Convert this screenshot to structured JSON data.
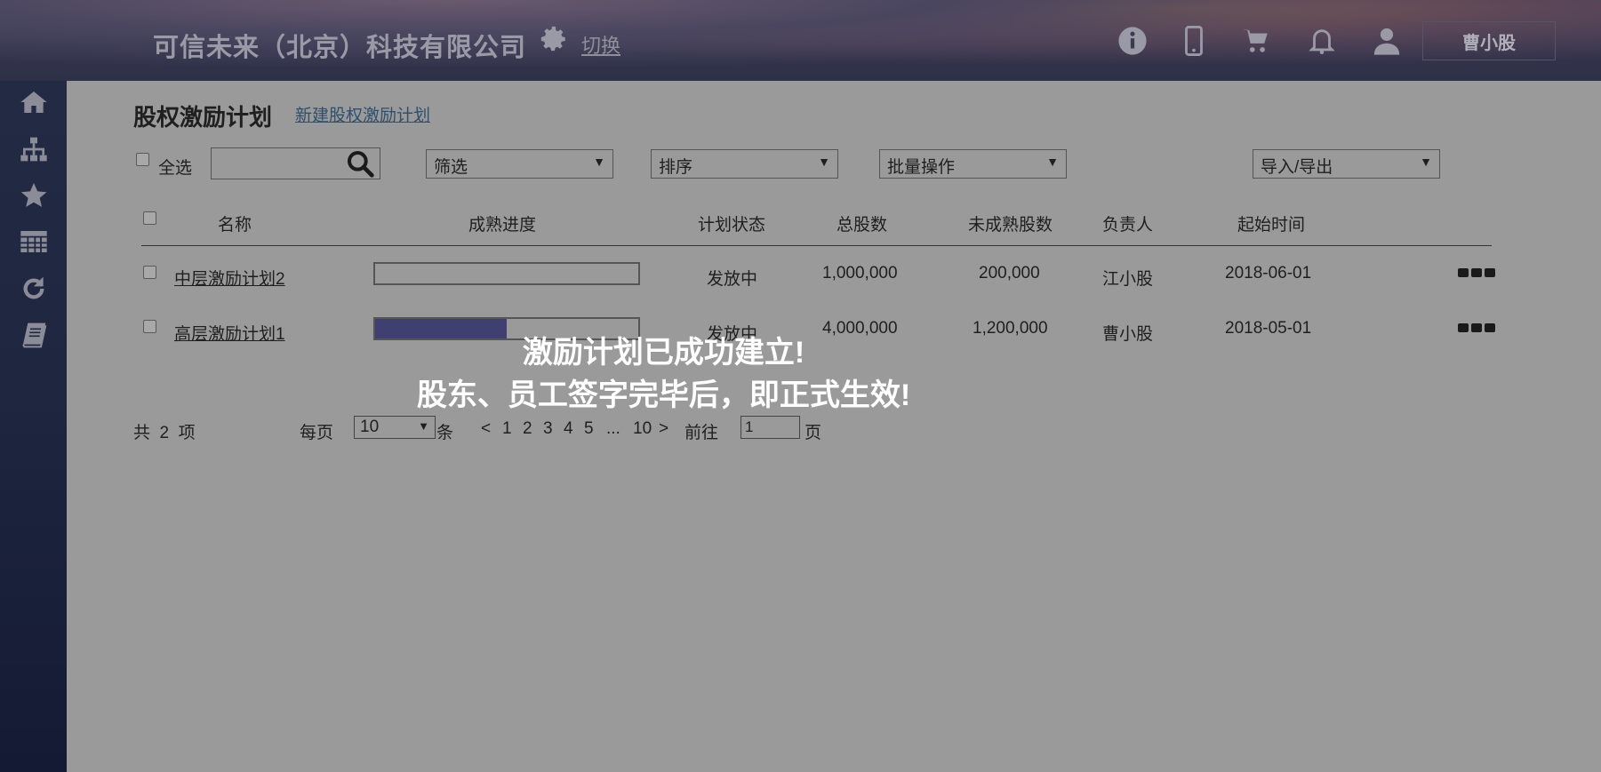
{
  "header": {
    "company": "可信未来（北京）科技有限公司",
    "switch_label": "切换",
    "user_name": "曹小股",
    "icons": [
      "settings-gear-icon",
      "info-icon",
      "mobile-phone-icon",
      "cart-icon",
      "bell-icon",
      "user-icon"
    ]
  },
  "sidebar": {
    "icons": [
      "home-icon",
      "org-chart-icon",
      "star-icon",
      "table-icon",
      "refresh-icon",
      "book-icon"
    ]
  },
  "page": {
    "title": "股权激励计划",
    "new_plan_link": "新建股权激励计划"
  },
  "toolbar": {
    "select_all": "全选",
    "search_value": "",
    "filter": "筛选",
    "sort": "排序",
    "batch": "批量操作",
    "import_export": "导入/导出"
  },
  "table": {
    "columns": [
      "名称",
      "成熟进度",
      "计划状态",
      "总股数",
      "未成熟股数",
      "负责人",
      "起始时间"
    ],
    "rows": [
      {
        "name": "中层激励计划2",
        "progress": 0.0,
        "status": "发放中",
        "total": "1,000,000",
        "unvested": "200,000",
        "owner": "江小股",
        "start": "2018-06-01"
      },
      {
        "name": "高层激励计划1",
        "progress": 0.5,
        "status": "发放中",
        "total": "4,000,000",
        "unvested": "1,200,000",
        "owner": "曹小股",
        "start": "2018-05-01"
      }
    ]
  },
  "pagination": {
    "total_text": "共  2  项",
    "per_page_label": "每页",
    "per_page_value": "10",
    "per_page_unit": "条",
    "prev": "<",
    "pages": [
      "1",
      "2",
      "3",
      "4",
      "5",
      "...",
      "10"
    ],
    "next": ">",
    "goto_label": "前往",
    "goto_value": "1",
    "page_unit": "页"
  },
  "toast": {
    "line1": "激励计划已成功建立!",
    "line2": "股东、员工签字完毕后，即正式生效!"
  },
  "colors": {
    "progress_fill": "#3f3f72",
    "overlay_gray": "#9a9a9a",
    "toast_text": "#ffffff"
  }
}
